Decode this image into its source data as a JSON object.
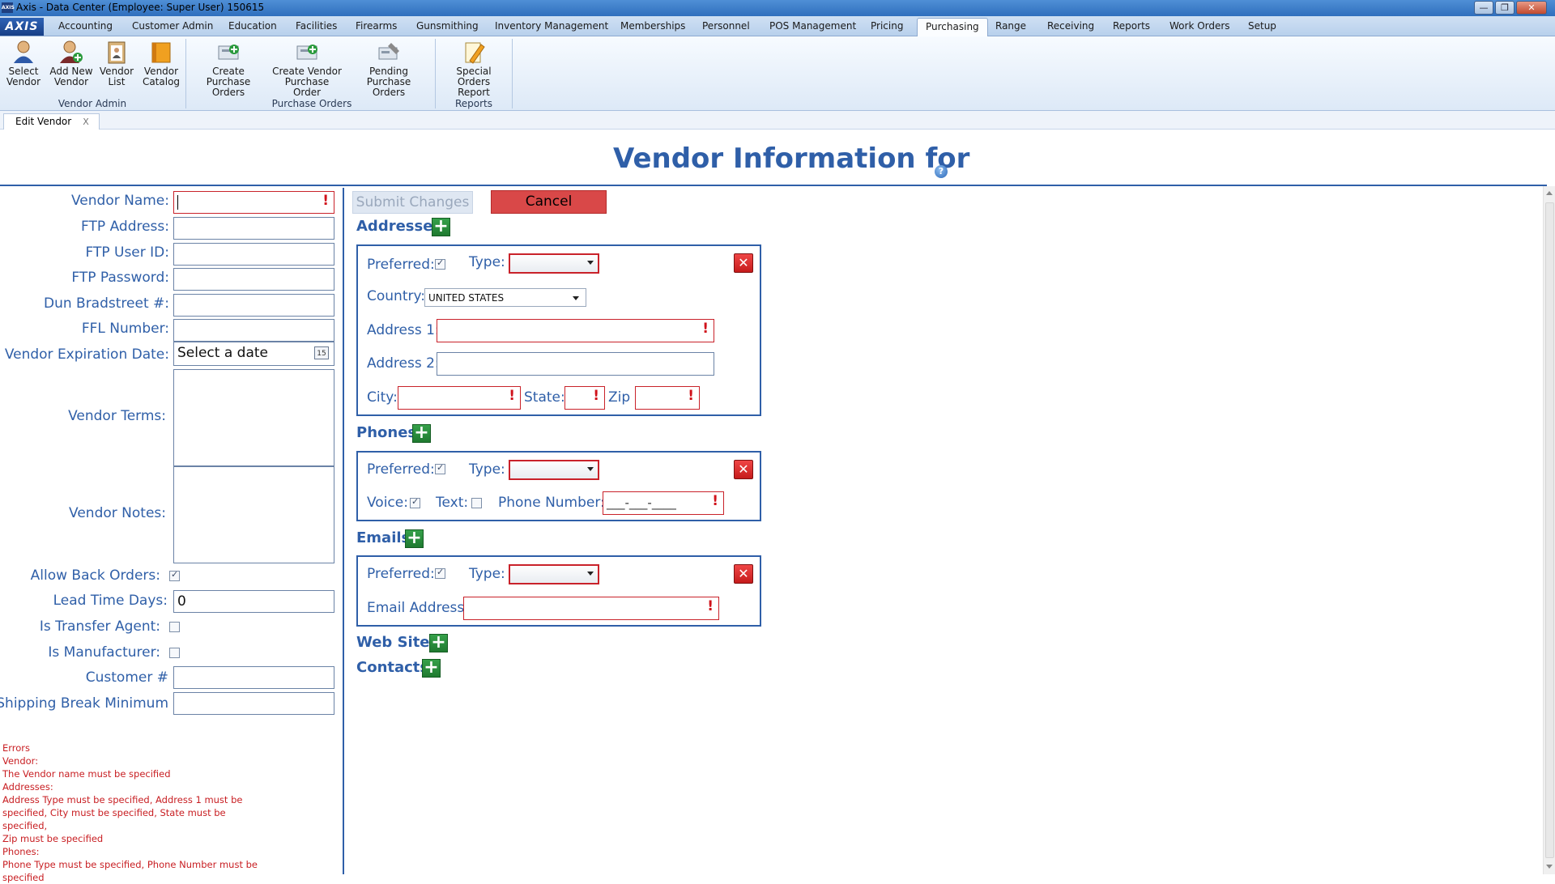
{
  "window": {
    "title": "Axis - Data Center  (Employee: Super User) 150615",
    "minimize": "—",
    "maximize": "❐",
    "close": "✕"
  },
  "menu": {
    "logo": "AXIS",
    "tabs": [
      "Accounting",
      "Customer Admin",
      "Education",
      "Facilities",
      "Firearms",
      "Gunsmithing",
      "Inventory Management",
      "Memberships",
      "Personnel",
      "POS Management",
      "Pricing",
      "Purchasing",
      "Range",
      "Receiving",
      "Reports",
      "Work Orders",
      "Setup"
    ],
    "active": "Purchasing"
  },
  "ribbon": {
    "buttons": [
      {
        "line1": "Select",
        "line2": "Vendor"
      },
      {
        "line1": "Add New",
        "line2": "Vendor"
      },
      {
        "line1": "Vendor",
        "line2": "List"
      },
      {
        "line1": "Vendor",
        "line2": "Catalog"
      },
      {
        "line1": "Create Purchase",
        "line2": "Orders"
      },
      {
        "line1": "Create Vendor",
        "line2": "Purchase Order"
      },
      {
        "line1": "Pending Purchase",
        "line2": "Orders"
      },
      {
        "line1": "Special Orders",
        "line2": "Report"
      }
    ],
    "groups": [
      "Vendor Admin",
      "Purchase Orders",
      "Reports"
    ]
  },
  "doc_tab": {
    "label": "Edit Vendor",
    "close": "X"
  },
  "page": {
    "title": "Vendor Information for",
    "help": "?"
  },
  "form": {
    "vendor_name_label": "Vendor Name:",
    "ftp_address_label": "FTP Address:",
    "ftp_user_label": "FTP User ID:",
    "ftp_password_label": "FTP Password:",
    "dun_label": "Dun Bradstreet #:",
    "ffl_label": "FFL Number:",
    "expiration_label": "Vendor Expiration Date:",
    "expiration_placeholder": "Select a date",
    "calendar_day": "15",
    "terms_label": "Vendor Terms:",
    "notes_label": "Vendor Notes:",
    "allow_back_orders_label": "Allow Back Orders:",
    "allow_back_orders": true,
    "lead_time_label": "Lead Time Days:",
    "lead_time_value": "0",
    "transfer_agent_label": "Is Transfer Agent:",
    "transfer_agent": false,
    "manufacturer_label": "Is Manufacturer:",
    "manufacturer": false,
    "customer_label": "Customer #",
    "shipping_label": "Shipping Break Minimum",
    "required_mark": "!"
  },
  "errors": [
    "Errors",
    "Vendor:",
    "The Vendor name must be specified",
    "Addresses:",
    "Address Type must be specified, Address 1 must be",
    "specified, City must be specified, State must be specified,",
    "Zip must be specified",
    "Phones:",
    "Phone Type must be specified, Phone Number must be",
    "specified"
  ],
  "actions": {
    "submit": "Submit Changes",
    "cancel": "Cancel"
  },
  "addresses": {
    "title": "Addresses",
    "preferred_label": "Preferred:",
    "type_label": "Type:",
    "country_label": "Country:",
    "country_value": "UNITED STATES",
    "address1_label": "Address 1:",
    "address2_label": "Address 2:",
    "city_label": "City:",
    "state_label": "State:",
    "zip_label": "Zip"
  },
  "phones": {
    "title": "Phones",
    "preferred_label": "Preferred:",
    "type_label": "Type:",
    "voice_label": "Voice:",
    "text_label": "Text:",
    "number_label": "Phone Number:",
    "number_mask": "___-___-____"
  },
  "emails": {
    "title": "Emails",
    "preferred_label": "Preferred:",
    "type_label": "Type:",
    "address_label": "Email Address:"
  },
  "websites": {
    "title": "Web Sites"
  },
  "contacts": {
    "title": "Contacts"
  },
  "icons": {
    "plus": "+",
    "delete": "✕"
  },
  "colors": {
    "accent": "#2f5fa8",
    "error": "#c81e22",
    "cancel": "#d94848",
    "add": "#2a8c3c"
  }
}
